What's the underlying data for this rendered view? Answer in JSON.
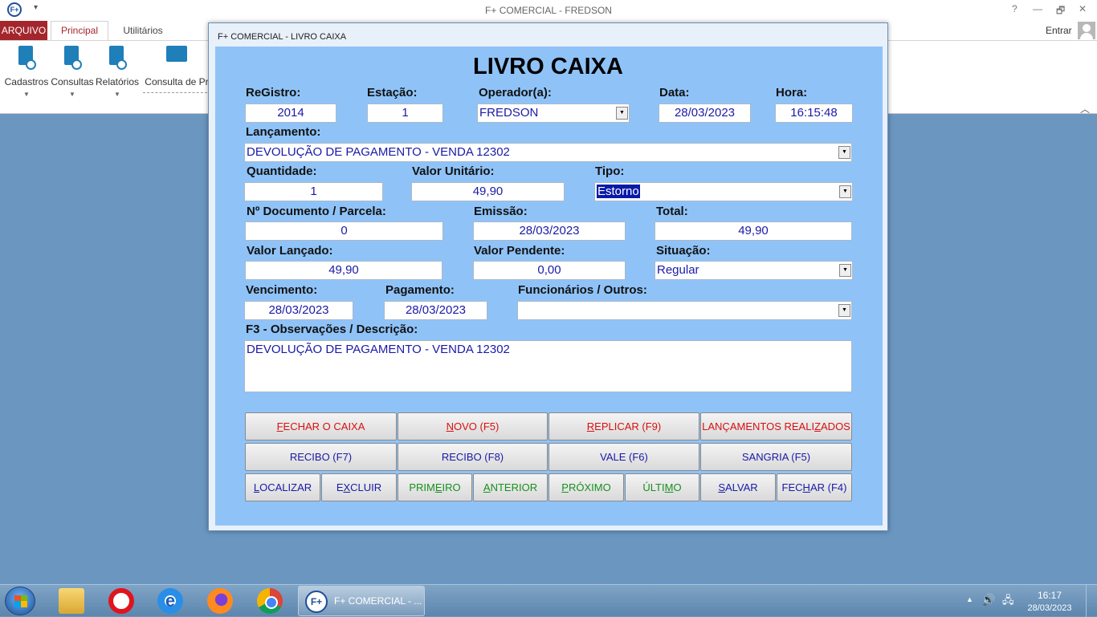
{
  "app": {
    "title": "F+ COMERCIAL - FREDSON",
    "logo": "F+",
    "controls": {
      "help": "?",
      "minimize": "—",
      "restore": "🗗",
      "close": "✕"
    }
  },
  "ribbon": {
    "tabs": {
      "arquivo": "ARQUIVO",
      "principal": "Principal",
      "utilitarios": "Utilitários"
    },
    "entrar": "Entrar",
    "buttons": {
      "cadastros": "Cadastros",
      "consultas": "Consultas",
      "relatorios": "Relatórios",
      "consulta_pr": "Consulta de Pr"
    }
  },
  "dialog": {
    "title": "F+ COMERCIAL - LIVRO CAIXA",
    "form_title": "LIVRO CAIXA",
    "labels": {
      "registro": "ReGistro:",
      "estacao": "Estação:",
      "operador": "Operador(a):",
      "data": "Data:",
      "hora": "Hora:",
      "lancamento": "Lançamento:",
      "quantidade": "Quantidade:",
      "valor_unitario": "Valor Unitário:",
      "tipo": "Tipo:",
      "documento": "Nº Documento / Parcela:",
      "emissao": "Emissão:",
      "total": "Total:",
      "valor_lancado": "Valor Lançado:",
      "valor_pendente": "Valor Pendente:",
      "situacao": "Situação:",
      "vencimento": "Vencimento:",
      "pagamento": "Pagamento:",
      "funcionarios": "Funcionários / Outros:",
      "observacoes": "F3 - Observações / Descrição:"
    },
    "values": {
      "registro": "2014",
      "estacao": "1",
      "operador": "FREDSON",
      "data": "28/03/2023",
      "hora": "16:15:48",
      "lancamento": "DEVOLUÇÃO DE PAGAMENTO - VENDA 12302",
      "quantidade": "1",
      "valor_unitario": "49,90",
      "tipo": "Estorno",
      "documento": "0",
      "emissao": "28/03/2023",
      "total": "49,90",
      "valor_lancado": "49,90",
      "valor_pendente": "0,00",
      "situacao": "Regular",
      "vencimento": "28/03/2023",
      "pagamento": "28/03/2023",
      "funcionarios": "",
      "observacoes": "DEVOLUÇÃO DE PAGAMENTO - VENDA 12302"
    },
    "buttons": {
      "fechar_caixa": {
        "pre": "",
        "u": "F",
        "post": "ECHAR O CAIXA"
      },
      "novo": {
        "pre": "",
        "u": "N",
        "post": "OVO (F5)"
      },
      "replicar": {
        "pre": "",
        "u": "R",
        "post": "EPLICAR (F9)"
      },
      "lancamentos": {
        "pre": "LANÇAMENTOS REALI",
        "u": "Z",
        "post": "ADOS"
      },
      "recibo_f7": {
        "pre": "RECIBO (F7)",
        "u": "",
        "post": ""
      },
      "recibo_f8": {
        "pre": "RECIBO (F8)",
        "u": "",
        "post": ""
      },
      "vale": {
        "pre": "VALE (F6)",
        "u": "",
        "post": ""
      },
      "sangria": {
        "pre": "SANGRIA (F5)",
        "u": "",
        "post": ""
      },
      "localizar": {
        "pre": "",
        "u": "L",
        "post": "OCALIZAR"
      },
      "excluir": {
        "pre": "E",
        "u": "X",
        "post": "CLUIR"
      },
      "primeiro": {
        "pre": "PRIM",
        "u": "E",
        "post": "IRO"
      },
      "anterior": {
        "pre": "",
        "u": "A",
        "post": "NTERIOR"
      },
      "proximo": {
        "pre": "",
        "u": "P",
        "post": "RÓXIMO"
      },
      "ultimo": {
        "pre": "ÚLTI",
        "u": "M",
        "post": "O"
      },
      "salvar": {
        "pre": "",
        "u": "S",
        "post": "ALVAR"
      },
      "fechar": {
        "pre": "FEC",
        "u": "H",
        "post": "AR (F4)"
      }
    }
  },
  "taskbar": {
    "task_label": "F+ COMERCIAL - ...",
    "task_icon": "F+",
    "time": "16:17",
    "date": "28/03/2023"
  },
  "colors": {
    "accent_red": "#a4262c",
    "panel_blue": "#8fc3f8",
    "value_blue": "#1a1aa8",
    "btn_red": "#d81010",
    "btn_green": "#18901e"
  }
}
